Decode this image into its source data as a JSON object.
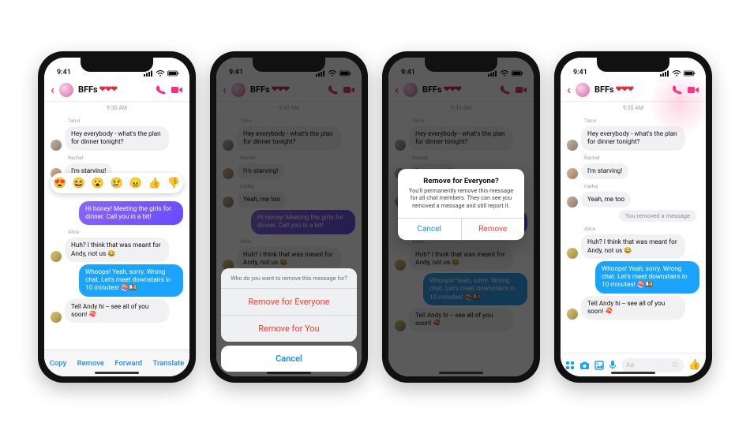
{
  "status": {
    "time": "9:41"
  },
  "header": {
    "title": "BFFs",
    "hearts": "❤❤❤"
  },
  "timestamp": "9:30 AM",
  "messages": {
    "tanvi_name": "Tanvi",
    "tanvi_text": "Hey everybody - what's the plan for dinner tonight?",
    "rachel_name": "Rachel",
    "rachel_text": "I'm starving!",
    "hailey_name": "Hailey",
    "hailey_text": "Yeah, me too",
    "own1": "Hi honey! Meeting the girls for dinner. Call you in a bit!",
    "alice_name": "Alice",
    "alice_text": "Huh? I think that was meant for Andy, not us 😂",
    "own2": "Whoops! Yeah, sorry. Wrong chat. Let's meet downstairs in 10 minutes! 🍣🍱",
    "alice2_text": "Tell Andy hi -- see all of you soon! 🍣",
    "removed": "You removed a message"
  },
  "reactions": {
    "r1": "😍",
    "r2": "😆",
    "r3": "😮",
    "r4": "😢",
    "r5": "😠",
    "r6": "👍",
    "r7": "👎"
  },
  "context": {
    "copy": "Copy",
    "remove": "Remove",
    "forward": "Forward",
    "translate": "Translate"
  },
  "sheet": {
    "header": "Who do you want to remove this message for?",
    "opt1": "Remove for Everyone",
    "opt2": "Remove for You",
    "cancel": "Cancel"
  },
  "alert": {
    "title": "Remove for Everyone?",
    "body": "You'll permanently remove this message for all chat members. They can see you removed a message and still report it.",
    "cancel": "Cancel",
    "remove": "Remove"
  },
  "composer": {
    "placeholder": "Aa"
  }
}
